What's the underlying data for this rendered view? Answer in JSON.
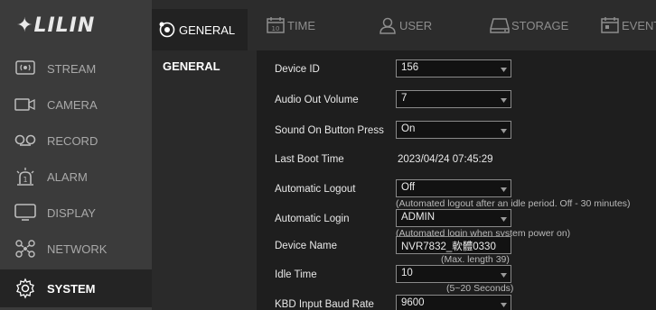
{
  "brand": {
    "logo_text": "LILIN",
    "logo_prefix": "✦"
  },
  "nav": {
    "items": [
      {
        "label": "STREAM",
        "icon": "stream-icon"
      },
      {
        "label": "CAMERA",
        "icon": "camera-icon"
      },
      {
        "label": "RECORD",
        "icon": "record-icon"
      },
      {
        "label": "ALARM",
        "icon": "alarm-icon"
      },
      {
        "label": "DISPLAY",
        "icon": "display-icon"
      },
      {
        "label": "NETWORK",
        "icon": "network-icon"
      },
      {
        "label": "SYSTEM",
        "icon": "gear-icon",
        "active": true
      }
    ]
  },
  "tabs": [
    {
      "label": "GENERAL",
      "icon": "general-icon",
      "active": true
    },
    {
      "label": "TIME",
      "icon": "calendar-icon"
    },
    {
      "label": "USER",
      "icon": "user-icon"
    },
    {
      "label": "STORAGE",
      "icon": "storage-icon"
    },
    {
      "label": "EVENT",
      "icon": "event-icon"
    }
  ],
  "subnav": {
    "items": [
      {
        "label": "GENERAL"
      }
    ]
  },
  "form": {
    "device_id": {
      "label": "Device ID",
      "value": "156"
    },
    "audio_out_volume": {
      "label": "Audio Out Volume",
      "value": "7"
    },
    "sound_on_button_press": {
      "label": "Sound On Button Press",
      "value": "On"
    },
    "last_boot_time": {
      "label": "Last Boot Time",
      "value": "2023/04/24 07:45:29"
    },
    "automatic_logout": {
      "label": "Automatic Logout",
      "value": "Off",
      "hint": "(Automated logout after an idle period. Off - 30 minutes)"
    },
    "automatic_login": {
      "label": "Automatic Login",
      "value": "ADMIN",
      "hint": "(Automated login when system power on)"
    },
    "device_name": {
      "label": "Device Name",
      "value": "NVR7832_軟體0330",
      "hint": "(Max. length 39)"
    },
    "idle_time": {
      "label": "Idle Time",
      "value": "10",
      "hint": "(5~20 Seconds)"
    },
    "kbd_input_baud_rate": {
      "label": "KBD Input Baud Rate",
      "value": "9600"
    }
  },
  "colors": {
    "accent": "#ffffff",
    "nav_bg": "#3b3b3b",
    "content_bg": "#1e1e1e",
    "input_border": "#8a8a8a"
  }
}
